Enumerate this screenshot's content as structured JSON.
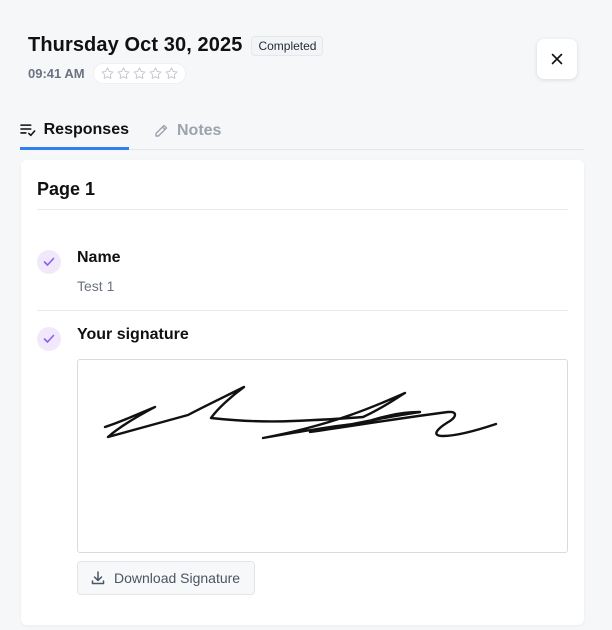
{
  "header": {
    "title": "Thursday Oct 30, 2025",
    "status_badge": "Completed",
    "time": "09:41 AM",
    "rating": 0,
    "rating_max": 5
  },
  "tabs": [
    {
      "label": "Responses",
      "icon": "list-check-icon",
      "active": true
    },
    {
      "label": "Notes",
      "icon": "pencil-icon",
      "active": false
    }
  ],
  "page": {
    "title": "Page 1",
    "questions": [
      {
        "label": "Name",
        "value": "Test 1",
        "icon": "check-icon"
      },
      {
        "label": "Your signature",
        "icon": "check-icon"
      }
    ],
    "download_label": "Download Signature"
  },
  "colors": {
    "accent": "#2f80ed",
    "check_bg": "#f1e9fb",
    "check_mark": "#8b5cf6"
  }
}
